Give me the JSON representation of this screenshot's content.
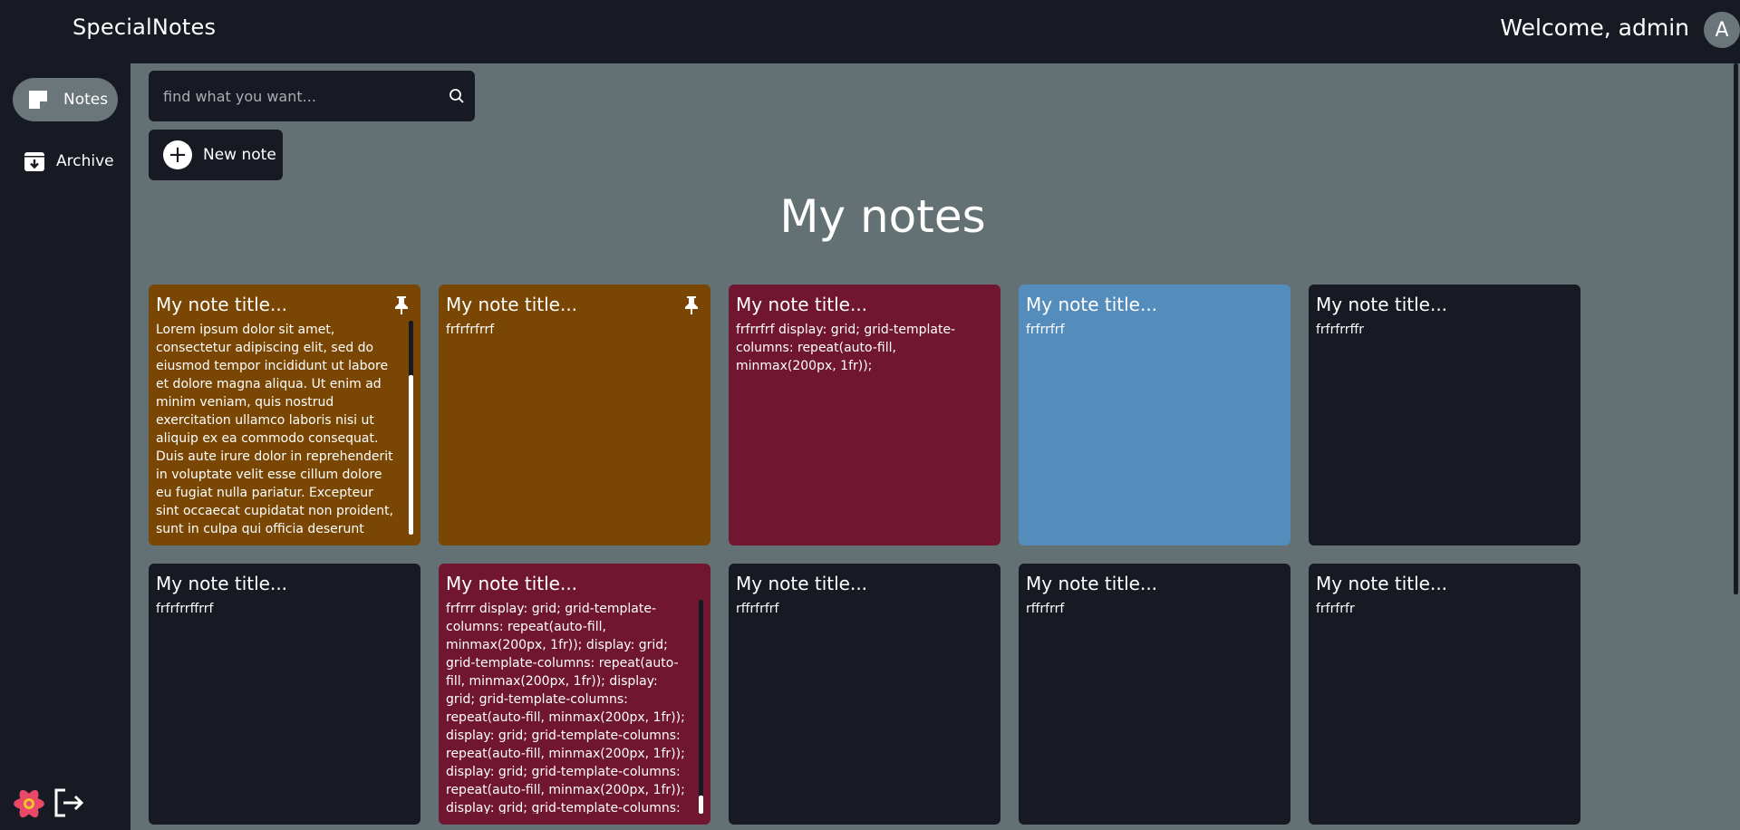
{
  "app": {
    "title": "SpecialNotes",
    "welcome": "Welcome, admin",
    "avatar_initial": "A"
  },
  "sidebar": {
    "items": [
      {
        "label": "Notes",
        "icon": "note-icon",
        "active": true
      },
      {
        "label": "Archive",
        "icon": "archive-icon",
        "active": false
      }
    ],
    "bottom_icons": [
      "react-logo-icon",
      "logout-icon"
    ]
  },
  "search": {
    "placeholder": "find what you want...",
    "value": "",
    "icon": "search-icon"
  },
  "new_note": {
    "label": "New note",
    "icon": "plus-icon"
  },
  "page": {
    "heading": "My notes"
  },
  "colors": {
    "background": "#171a22",
    "main": "#647174",
    "brown": "#7a4603",
    "crimson": "#711630",
    "blue": "#548dbb",
    "dark": "#171a22"
  },
  "notes": [
    {
      "title": "My note title...",
      "body": "Lorem ipsum dolor sit amet, consectetur adipiscing elit, sed do eiusmod tempor incididunt ut labore et dolore magna aliqua. Ut enim ad minim veniam, quis nostrud exercitation ullamco laboris nisi ut aliquip ex ea commodo consequat. Duis aute irure dolor in reprehenderit in voluptate velit esse cillum dolore eu fugiat nulla pariatur. Excepteur sint occaecat cupidatat non proident, sunt in culpa qui officia deserunt mollit",
      "color": "#7a4603",
      "pinned": true
    },
    {
      "title": "My note title...",
      "body": "frfrfrfrrf",
      "color": "#7a4603",
      "pinned": true
    },
    {
      "title": "My note title...",
      "body": "frfrrfrf display: grid; grid-template-columns: repeat(auto-fill, minmax(200px, 1fr));",
      "color": "#711630",
      "pinned": false
    },
    {
      "title": "My note title...",
      "body": "frfrrfrf",
      "color": "#548dbb",
      "pinned": false
    },
    {
      "title": "My note title...",
      "body": "frfrfrrffr",
      "color": "#171a22",
      "pinned": false
    },
    {
      "title": "My note title...",
      "body": "frfrfrrffrrf",
      "color": "#171a22",
      "pinned": false
    },
    {
      "title": "My note title...",
      "body": "frfrrr display: grid; grid-template-columns: repeat(auto-fill, minmax(200px, 1fr)); display: grid; grid-template-columns: repeat(auto-fill, minmax(200px, 1fr)); display: grid; grid-template-columns: repeat(auto-fill, minmax(200px, 1fr)); display: grid; grid-template-columns: repeat(auto-fill, minmax(200px, 1fr)); display: grid; grid-template-columns: repeat(auto-fill, minmax(200px, 1fr)); display: grid; grid-template-columns: repeat(auto-fill,",
      "color": "#711630",
      "pinned": false
    },
    {
      "title": "My note title...",
      "body": "rffrfrfrf",
      "color": "#171a22",
      "pinned": false
    },
    {
      "title": "My note title...",
      "body": "rffrfrrf",
      "color": "#171a22",
      "pinned": false
    },
    {
      "title": "My note title...",
      "body": "frfrfrfr",
      "color": "#171a22",
      "pinned": false
    }
  ]
}
